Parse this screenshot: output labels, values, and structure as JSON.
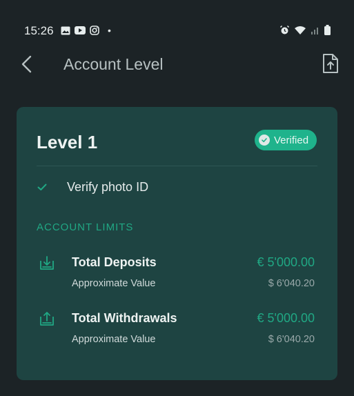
{
  "status_bar": {
    "time": "15:26",
    "dot": "•"
  },
  "nav": {
    "title": "Account Level"
  },
  "card": {
    "level_title": "Level 1",
    "badge_label": "Verified",
    "requirement": "Verify photo ID",
    "section_title": "ACCOUNT LIMITS",
    "limits": [
      {
        "title": "Total Deposits",
        "value": "€ 5'000.00",
        "sub_label": "Approximate Value",
        "sub_value": "$ 6'040.20",
        "icon": "download-icon"
      },
      {
        "title": "Total Withdrawals",
        "value": "€ 5'000.00",
        "sub_label": "Approximate Value",
        "sub_value": "$ 6'040.20",
        "icon": "upload-icon"
      }
    ]
  },
  "colors": {
    "background": "#1c2326",
    "card": "#1e4442",
    "accent": "#1fb38c",
    "accent_text": "#20a884"
  }
}
